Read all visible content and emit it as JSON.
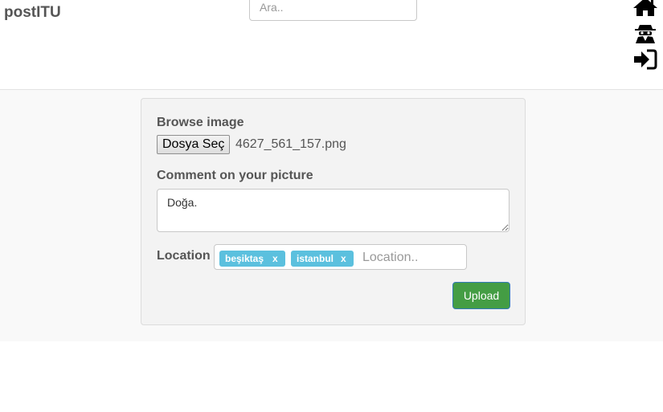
{
  "navbar": {
    "brand": "postITU",
    "search_placeholder": "Ara..",
    "icons": [
      "home-icon",
      "spy-icon",
      "sign-in-icon"
    ]
  },
  "form": {
    "browse_label": "Browse image",
    "file_button_label": "Dosya Seç",
    "file_name": "4627_561_157.png",
    "comment_label": "Comment on your picture",
    "comment_value": "Doğa.",
    "location_label": "Location",
    "location_tags": [
      {
        "label": "beşiktaş",
        "remove": "x"
      },
      {
        "label": "istanbul",
        "remove": "x"
      }
    ],
    "location_placeholder": "Location..",
    "upload_label": "Upload"
  },
  "colors": {
    "tag": "#5bc0de",
    "upload_button": "#449d44",
    "upload_border": "#337ab7"
  }
}
